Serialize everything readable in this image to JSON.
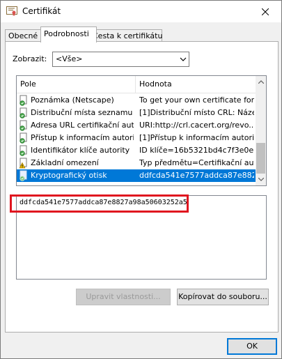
{
  "window": {
    "title": "Certifikát"
  },
  "tabs": [
    {
      "label": "Obecné"
    },
    {
      "label": "Podrobnosti"
    },
    {
      "label": "Cesta k certifikátu"
    }
  ],
  "show": {
    "label": "Zobrazit:",
    "value": "<Vše>"
  },
  "list": {
    "headers": {
      "field": "Pole",
      "value": "Hodnota"
    },
    "rows": [
      {
        "name": "Poznámka (Netscape)",
        "value": "To get your own certificate for...",
        "icon": "cert-field-icon"
      },
      {
        "name": "Distribuční místa seznamu o...",
        "value": "[1]Distribuční místo CRL: Náze...",
        "icon": "cert-field-icon"
      },
      {
        "name": "Adresa URL certifikační autor...",
        "value": "URI:http://crl.cacert.org/revo...",
        "icon": "cert-field-icon"
      },
      {
        "name": "Přístup k informacím autority",
        "value": "[1]Přístup k informacím autorit...",
        "icon": "cert-field-icon"
      },
      {
        "name": "Identifikátor klíče autority",
        "value": "ID klíče=16b5321bd4c7f3e0e6...",
        "icon": "cert-field-icon"
      },
      {
        "name": "Základní omezení",
        "value": "Typ předmětu=Certifikační aut...",
        "icon": "warning-icon"
      },
      {
        "name": "Kryptografický otisk",
        "value": "ddfcda541e7577addca87e882...",
        "icon": "cert-field-icon"
      }
    ]
  },
  "detail": {
    "text": "ddfcda541e7577addca87e8827a98a50603252a5"
  },
  "buttons": {
    "edit": "Upravit vlastnosti...",
    "copy": "Kopírovat do souboru...",
    "ok": "OK"
  }
}
